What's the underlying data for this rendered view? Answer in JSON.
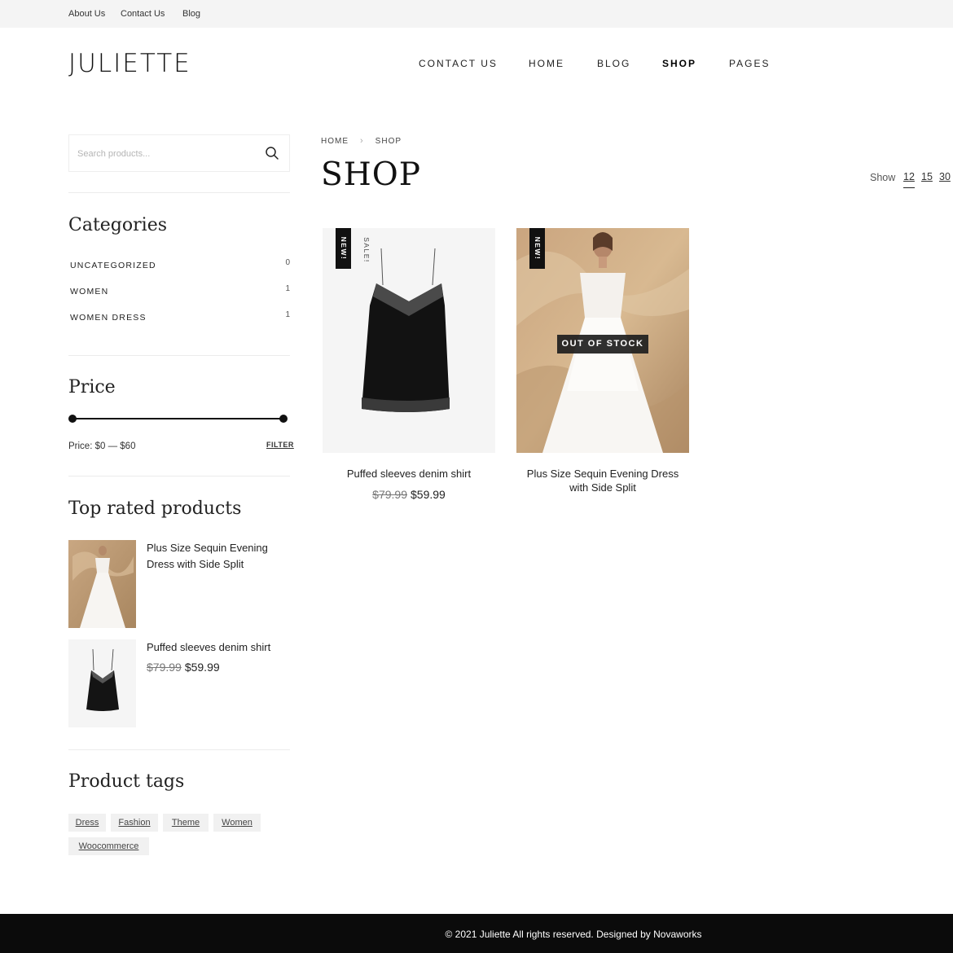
{
  "topbar": {
    "links": [
      "About Us",
      "Contact Us",
      "Blog"
    ]
  },
  "header": {
    "logo": "JULIETTE",
    "nav": [
      "CONTACT US",
      "HOME",
      "BLOG",
      "SHOP",
      "PAGES"
    ],
    "active": "SHOP"
  },
  "sidebar": {
    "search_placeholder": "Search products...",
    "categories_title": "Categories",
    "categories": [
      {
        "name": "UNCATEGORIZED",
        "count": "0"
      },
      {
        "name": "WOMEN",
        "count": "1"
      },
      {
        "name": "WOMEN DRESS",
        "count": "1"
      }
    ],
    "price_title": "Price",
    "price_range_label": "Price: $0 — $60",
    "price_slider": {
      "min": 0,
      "max": 60
    },
    "filter_label": "FILTER",
    "top_rated_title": "Top rated products",
    "top_rated": [
      {
        "name": "Plus Size Sequin Evening Dress with Side Split",
        "old_price": "",
        "price": ""
      },
      {
        "name": "Puffed sleeves denim shirt",
        "old_price": "$79.99",
        "price": "$59.99"
      }
    ],
    "tags_title": "Product tags",
    "tags": [
      "Dress",
      "Fashion",
      "Theme",
      "Women",
      "Woocommerce"
    ]
  },
  "main": {
    "breadcrumb": [
      "HOME",
      "SHOP"
    ],
    "breadcrumb_sep": "›",
    "title": "SHOP",
    "show_label": "Show",
    "show_options": [
      "12",
      "15",
      "30"
    ],
    "show_active": "12",
    "products": [
      {
        "name": "Puffed sleeves denim shirt",
        "old_price": "$79.99",
        "price": "$59.99",
        "badges": [
          "NEW!",
          "SALE!"
        ],
        "out_of_stock": ""
      },
      {
        "name": "Plus Size Sequin Evening Dress with Side Split",
        "old_price": "",
        "price": "",
        "badges": [
          "NEW!"
        ],
        "out_of_stock": "OUT OF STOCK"
      }
    ]
  },
  "footer": {
    "text": "© 2021 Juliette All rights reserved. Designed by Novaworks"
  },
  "colors": {
    "accent": "#111111",
    "topbar_bg": "#f4f4f4",
    "footer_bg": "#0b0b0b",
    "tag_bg": "#f1f1f1"
  }
}
